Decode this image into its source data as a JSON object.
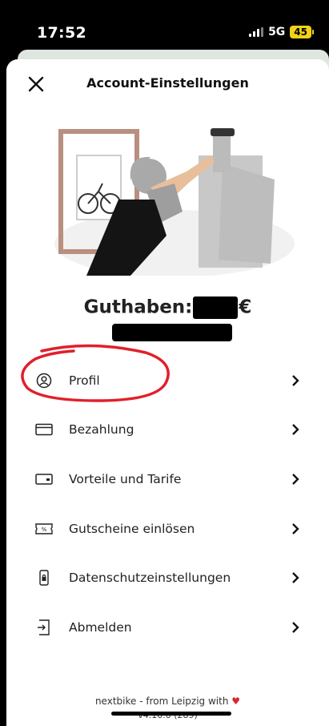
{
  "status": {
    "time": "17:52",
    "network": "5G",
    "battery": "45"
  },
  "header": {
    "title": "Account-Einstellungen"
  },
  "balance": {
    "label": "Guthaben:",
    "currency": "€"
  },
  "menu": [
    {
      "label": "Profil",
      "icon": "user-circle-icon"
    },
    {
      "label": "Bezahlung",
      "icon": "credit-card-icon"
    },
    {
      "label": "Vorteile und Tarife",
      "icon": "wallet-icon"
    },
    {
      "label": "Gutscheine einlösen",
      "icon": "voucher-icon"
    },
    {
      "label": "Datenschutzeinstellungen",
      "icon": "lock-icon"
    },
    {
      "label": "Abmelden",
      "icon": "logout-icon"
    }
  ],
  "footer": {
    "credit": "nextbike - from Leipzig with",
    "version": "v4.10.0 (289)"
  },
  "colors": {
    "annotation": "#e0202a",
    "heart": "#d8262c",
    "battery": "#f2d218"
  }
}
